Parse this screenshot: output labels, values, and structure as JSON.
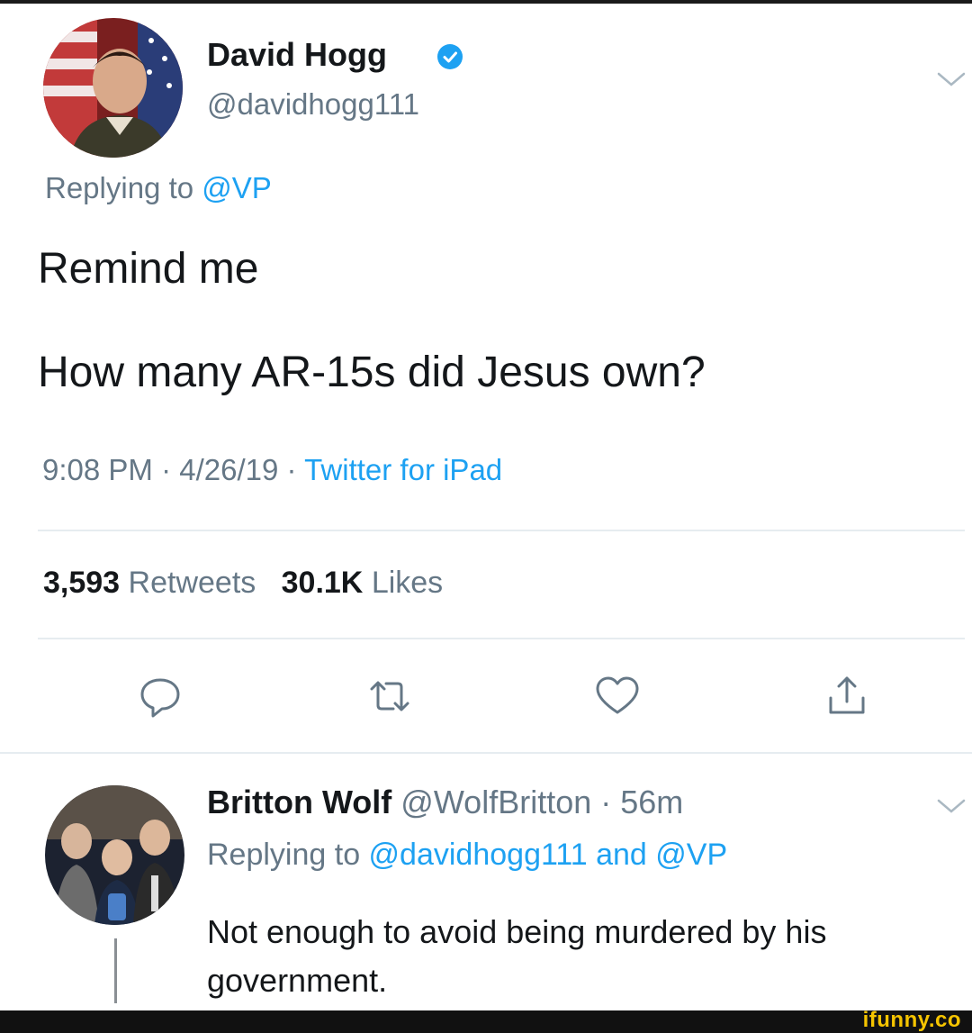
{
  "tweet": {
    "author_name": "David Hogg",
    "author_handle": "@davidhogg111",
    "replying_prefix": "Replying to ",
    "replying_to": "@VP",
    "text_line1": "Remind me",
    "text_line2": "How many AR-15s did Jesus own?",
    "time": "9:08 PM",
    "date": "4/26/19",
    "source": "Twitter for iPad",
    "separator": " · ",
    "retweets_count": "3,593",
    "retweets_label": "Retweets",
    "likes_count": "30.1K",
    "likes_label": "Likes"
  },
  "actions": [
    {
      "icon": "reply-icon"
    },
    {
      "icon": "retweet-icon"
    },
    {
      "icon": "like-icon"
    },
    {
      "icon": "share-icon"
    }
  ],
  "reply": {
    "author_name": "Britton Wolf",
    "author_handle": "@WolfBritton",
    "age": "56m",
    "replying_prefix": "Replying to ",
    "replying_to_1": "@davidhogg111",
    "conjunction": " and ",
    "replying_to_2": "@VP",
    "text": "Not enough to avoid being murdered by his government."
  },
  "watermark": "ifunny.co",
  "colors": {
    "link": "#1da1f2",
    "muted": "#657786",
    "text": "#14171a",
    "verified": "#1da1f2",
    "watermark": "#f5c400"
  }
}
